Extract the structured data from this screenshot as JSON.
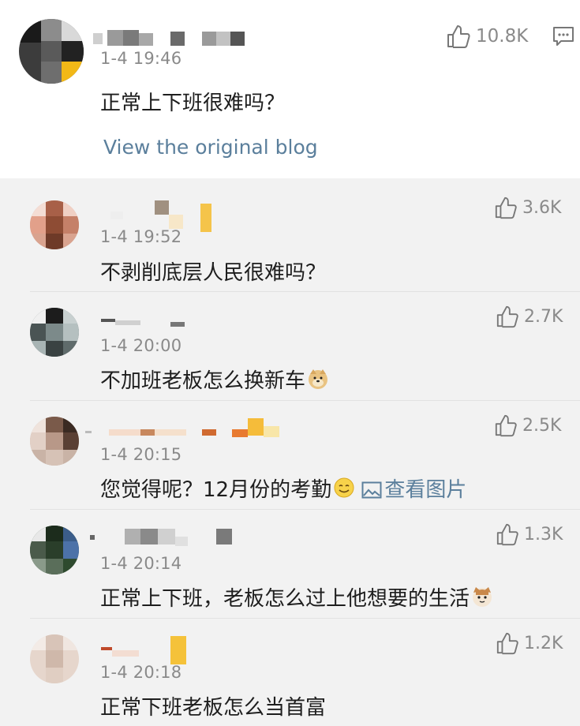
{
  "main_post": {
    "time": "1-4 19:46",
    "text": "正常上下班很难吗？",
    "likes": "10.8K",
    "view_original_label": "View the original blog",
    "like_icon": "thumbs-up-icon",
    "comment_icon": "comment-icon"
  },
  "replies": [
    {
      "time": "1-4 19:52",
      "text": "不剥削底层人民很难吗？",
      "likes": "3.6K"
    },
    {
      "time": "1-4 20:00",
      "text": "不加班老板怎么换新车",
      "likes": "2.7K",
      "emoji": "doge-emoji"
    },
    {
      "time": "1-4 20:15",
      "text": "您觉得呢？12月份的考勤",
      "likes": "2.5K",
      "emoji": "smile-emoji",
      "image_link": "查看图片"
    },
    {
      "time": "1-4 20:14",
      "text": "正常上下班，老板怎么过上他想要的生活",
      "likes": "1.3K",
      "emoji": "cat-emoji"
    },
    {
      "time": "1-4 20:18",
      "text": "正常下班老板怎么当首富",
      "likes": "1.2K"
    }
  ],
  "colors": {
    "link": "#5b7f9c",
    "meta_gray": "#8a8a8a",
    "reply_bg": "#f2f2f2"
  }
}
